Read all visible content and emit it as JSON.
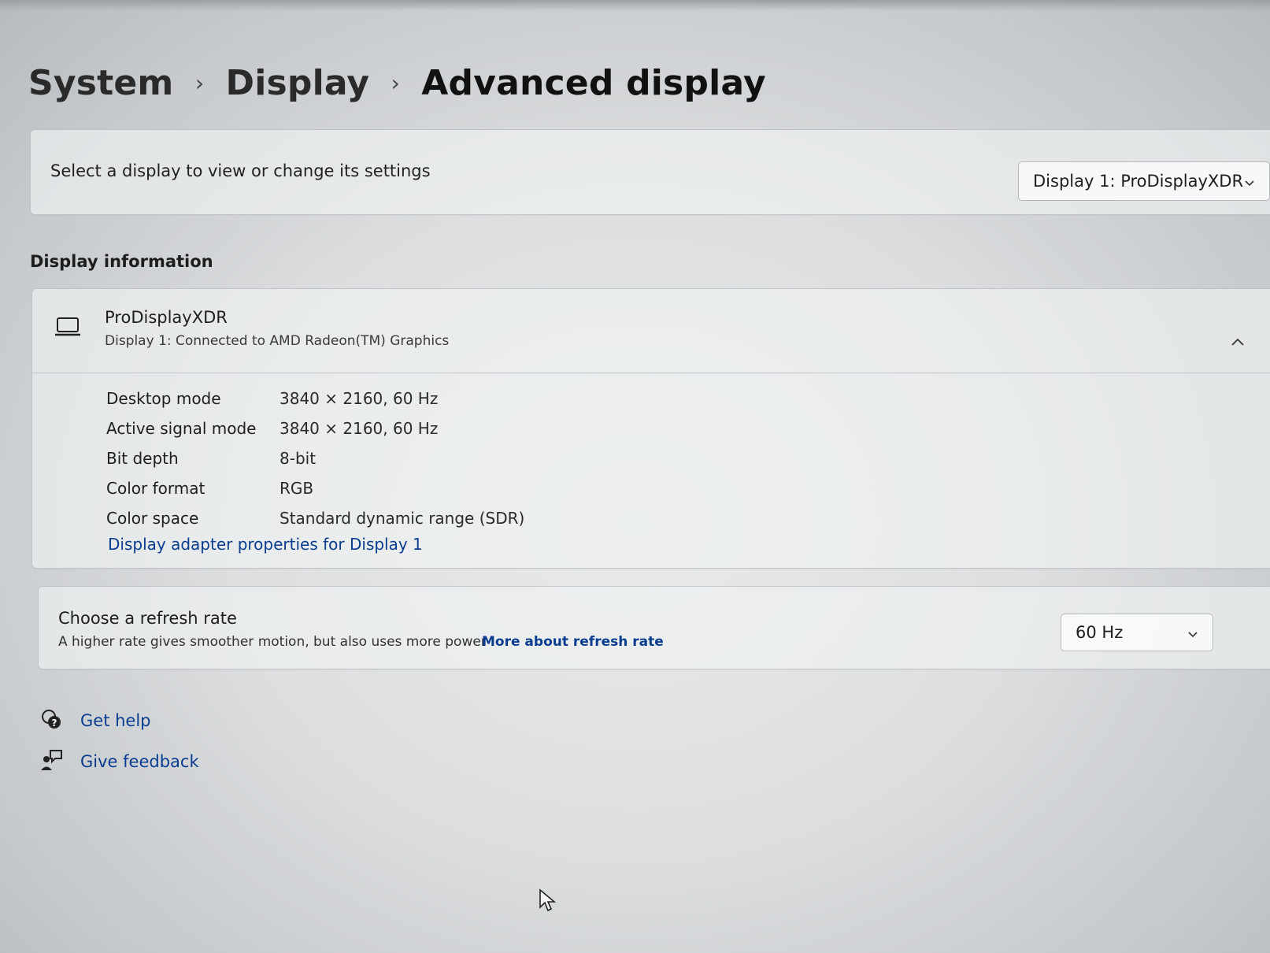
{
  "breadcrumb": {
    "items": [
      "System",
      "Display",
      "Advanced display"
    ],
    "separator": "›"
  },
  "display_select": {
    "label": "Select a display to view or change its settings",
    "selected": "Display 1: ProDisplayXDR"
  },
  "display_info": {
    "section_title": "Display information",
    "name": "ProDisplayXDR",
    "subtitle": "Display 1: Connected to AMD Radeon(TM) Graphics",
    "properties": [
      {
        "label": "Desktop mode",
        "value": "3840 × 2160, 60 Hz"
      },
      {
        "label": "Active signal mode",
        "value": "3840 × 2160, 60 Hz"
      },
      {
        "label": "Bit depth",
        "value": "8-bit"
      },
      {
        "label": "Color format",
        "value": "RGB"
      },
      {
        "label": "Color space",
        "value": "Standard dynamic range (SDR)"
      }
    ],
    "adapter_link": "Display adapter properties for Display 1"
  },
  "refresh_rate": {
    "title": "Choose a refresh rate",
    "description": "A higher rate gives smoother motion, but also uses more power",
    "link": "More about refresh rate",
    "selected": "60 Hz"
  },
  "footer_links": {
    "get_help": "Get help",
    "give_feedback": "Give feedback"
  },
  "colors": {
    "link": "#0a3d8f",
    "text": "#1b1b1b",
    "card_border": "#a0a5aa"
  },
  "icons": {
    "monitor": "monitor-icon",
    "help": "help-icon",
    "feedback": "feedback-icon",
    "chevron_down": "chevron-down-icon",
    "chevron_up": "chevron-up-icon",
    "cursor": "mouse-cursor-icon"
  }
}
